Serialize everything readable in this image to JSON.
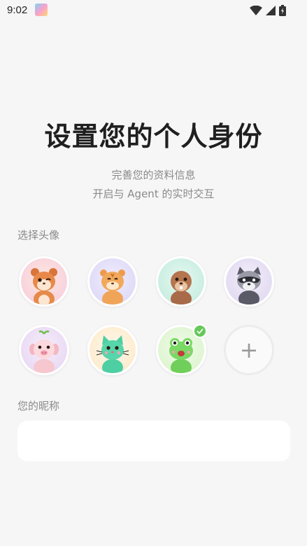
{
  "status_bar": {
    "time": "9:02"
  },
  "header": {
    "title": "设置您的个人身份",
    "subtitle_line1": "完善您的资料信息",
    "subtitle_line2": "开启与 Agent 的实时交互"
  },
  "avatar_section": {
    "label": "选择头像",
    "selected_index": 6,
    "avatars": [
      {
        "name": "squirrel",
        "bg": "#fbe3ec"
      },
      {
        "name": "tiger",
        "bg": "#e6e3fb"
      },
      {
        "name": "beaver",
        "bg": "#d7f3ea"
      },
      {
        "name": "raccoon",
        "bg": "#ece6f5"
      },
      {
        "name": "pig",
        "bg": "#f1e3f7"
      },
      {
        "name": "cat",
        "bg": "#fdf0dc"
      },
      {
        "name": "frog",
        "bg": "#e8f8df"
      }
    ],
    "add_symbol": "+"
  },
  "nickname_section": {
    "label": "您的昵称",
    "value": "",
    "placeholder": ""
  },
  "colors": {
    "background": "#f6f6f7",
    "accent_green": "#66c85a"
  }
}
